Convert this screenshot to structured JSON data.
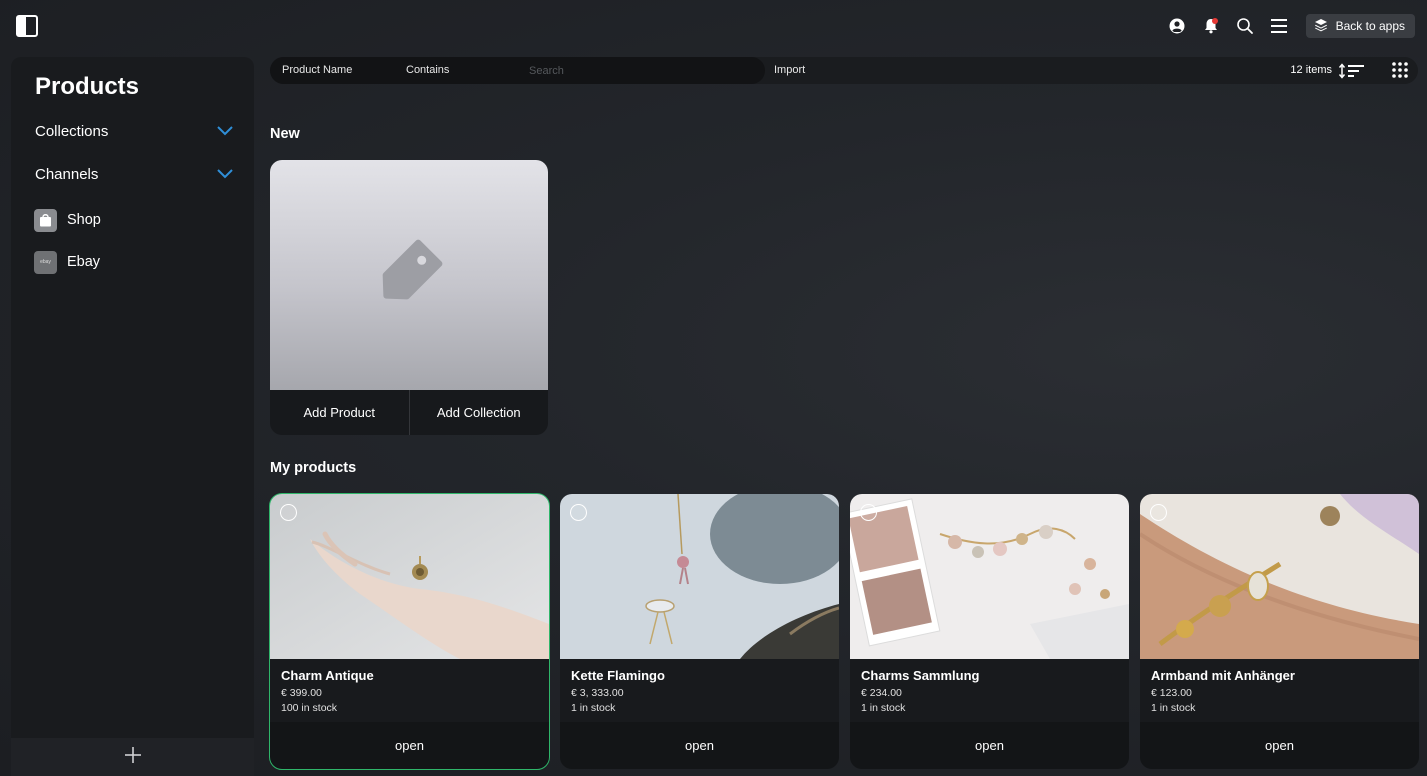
{
  "topbar": {
    "back_label": "Back to apps",
    "icons": [
      "sidebar-toggle-icon",
      "account-icon",
      "bell-icon",
      "search-icon",
      "menu-icon",
      "layers-icon"
    ],
    "notification_color": "#e53935"
  },
  "sidebar": {
    "title": "Products",
    "nav": [
      {
        "label": "Collections"
      },
      {
        "label": "Channels"
      }
    ],
    "channels": [
      {
        "label": "Shop",
        "icon": "shopping-bag-icon"
      },
      {
        "label": "Ebay",
        "icon": "ebay-icon",
        "icon_text": "ebay"
      }
    ],
    "accent_color": "#2f8fd8"
  },
  "filter": {
    "field": "Product Name",
    "operator": "Contains",
    "search_placeholder": "Search",
    "search_value": "",
    "import_label": "Import",
    "items_count": "12 items"
  },
  "new_section": {
    "title": "New",
    "add_product": "Add Product",
    "add_collection": "Add Collection",
    "placeholder_icon": "price-tag-icon"
  },
  "products_section": {
    "title": "My products",
    "selected_color": "#2fb66a",
    "products": [
      {
        "name": "Charm Antique",
        "price": "€ 399.00",
        "stock": "100 in stock",
        "action": "open",
        "selected": true
      },
      {
        "name": "Kette Flamingo",
        "price": "€ 3, 333.00",
        "stock": "1 in stock",
        "action": "open",
        "selected": false
      },
      {
        "name": "Charms Sammlung",
        "price": "€ 234.00",
        "stock": "1 in stock",
        "action": "open",
        "selected": false
      },
      {
        "name": "Armband mit Anhänger",
        "price": "€ 123.00",
        "stock": "1 in stock",
        "action": "open",
        "selected": false
      }
    ]
  }
}
